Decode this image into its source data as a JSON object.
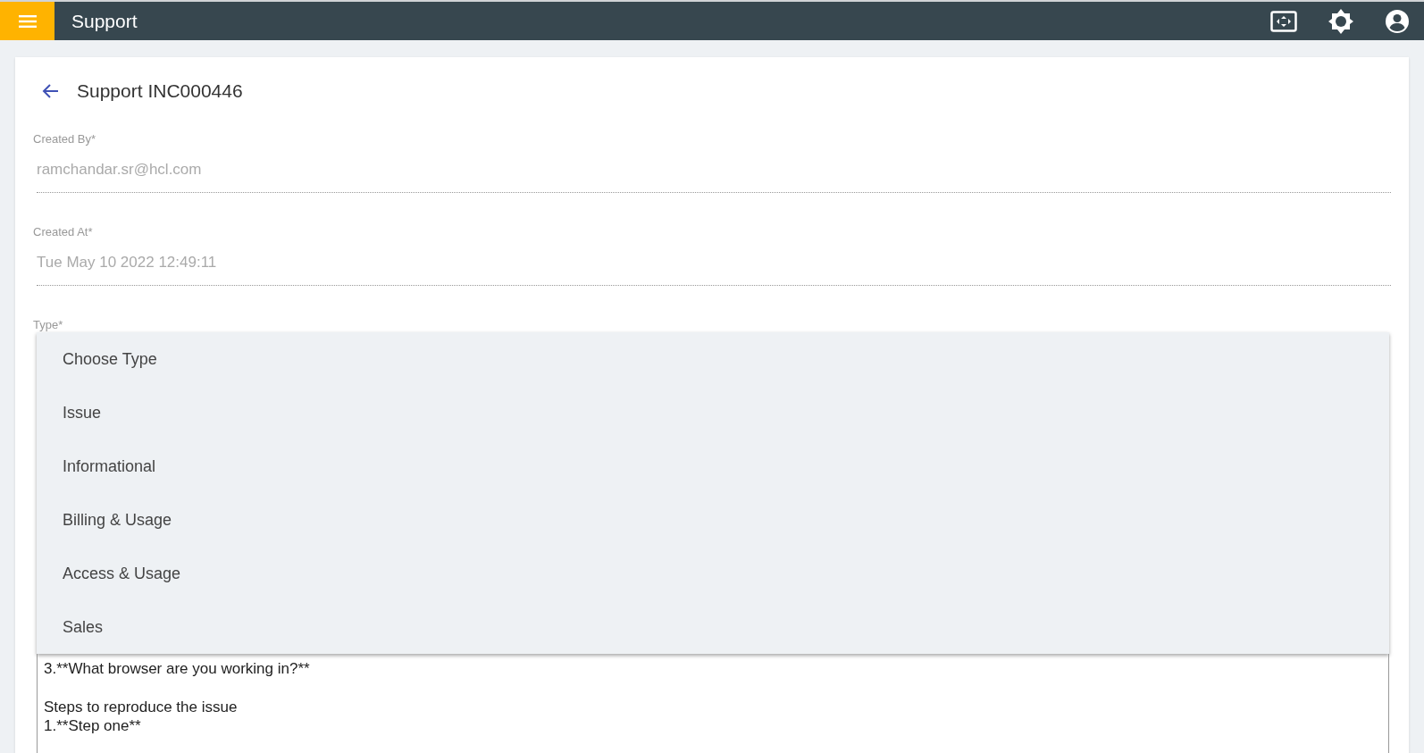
{
  "app_bar": {
    "title": "Support"
  },
  "page": {
    "title": "Support INC000446"
  },
  "fields": [
    {
      "label": "Created By*",
      "value": "ramchandar.sr@hcl.com",
      "disabled": true
    },
    {
      "label": "Created At*",
      "value": "Tue May 10 2022 12:49:11",
      "disabled": true
    }
  ],
  "type_field": {
    "label": "Type*",
    "expanded": true,
    "options": [
      "Choose Type",
      "Issue",
      "Informational",
      "Billing & Usage",
      "Access & Usage",
      "Sales"
    ]
  },
  "description": {
    "paragraphs": [
      [
        "3.**What browser are you working in?**"
      ],
      [
        "Steps to reproduce the issue",
        "1.**Step one**"
      ]
    ]
  }
}
